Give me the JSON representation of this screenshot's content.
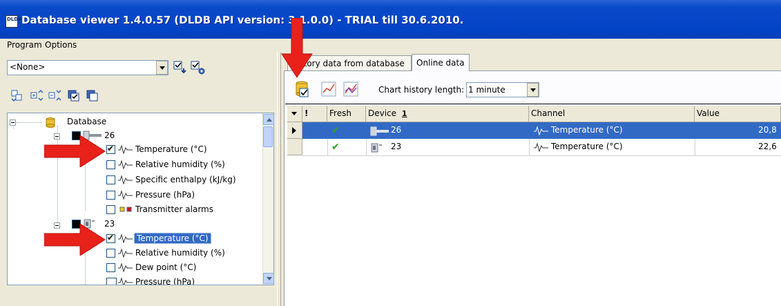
{
  "window": {
    "title": "Database viewer  1.4.0.57  (DLDB API version: 3.1.0.0) - TRIAL till 30.6.2010.",
    "icon_text": "DLDB"
  },
  "menu": {
    "items": [
      "Program",
      "Options"
    ]
  },
  "left": {
    "filter_combo_value": "<None>",
    "tree": {
      "root_label": "Database",
      "devices": [
        {
          "label": "26",
          "channels": [
            {
              "label": "Temperature (°C)",
              "checked": true,
              "icon": "waveform-icon"
            },
            {
              "label": "Relative humidity (%)",
              "checked": false,
              "icon": "waveform-icon"
            },
            {
              "label": "Specific enthalpy (kJ/kg)",
              "checked": false,
              "icon": "waveform-icon"
            },
            {
              "label": "Pressure (hPa)",
              "checked": false,
              "icon": "waveform-icon"
            },
            {
              "label": "Transmitter alarms",
              "checked": false,
              "icon": "alarm-icon"
            }
          ]
        },
        {
          "label": "23",
          "channels": [
            {
              "label": "Temperature (°C)",
              "checked": true,
              "icon": "waveform-icon",
              "selected": true
            },
            {
              "label": "Relative humidity (%)",
              "checked": false,
              "icon": "waveform-icon"
            },
            {
              "label": "Dew point (°C)",
              "checked": false,
              "icon": "waveform-icon"
            },
            {
              "label": "Pressure (hPa)",
              "checked": false,
              "icon": "waveform-icon"
            }
          ]
        }
      ]
    }
  },
  "right": {
    "tabs": [
      "History data from database",
      "Online data"
    ],
    "active_tab": "Online data",
    "tab_visible_prefix_covered": "...ry data from database",
    "chart_history_label": "Chart history length:",
    "chart_history_value": "1 minute",
    "grid": {
      "columns": [
        "!",
        "Fresh",
        "Device",
        "Channel",
        "Value"
      ],
      "sort_indicator": "1",
      "rows": [
        {
          "fresh": "✔",
          "device": "26",
          "channel": "Temperature (°C)",
          "value": "20,8",
          "selected": true
        },
        {
          "fresh": "✔",
          "device": "23",
          "channel": "Temperature (°C)",
          "value": "22,6",
          "selected": false
        }
      ]
    }
  },
  "colors": {
    "titlebar": "#0343c6",
    "selection": "#316ac5",
    "arrow": "#e8211b",
    "check_green": "#2e9c28"
  }
}
